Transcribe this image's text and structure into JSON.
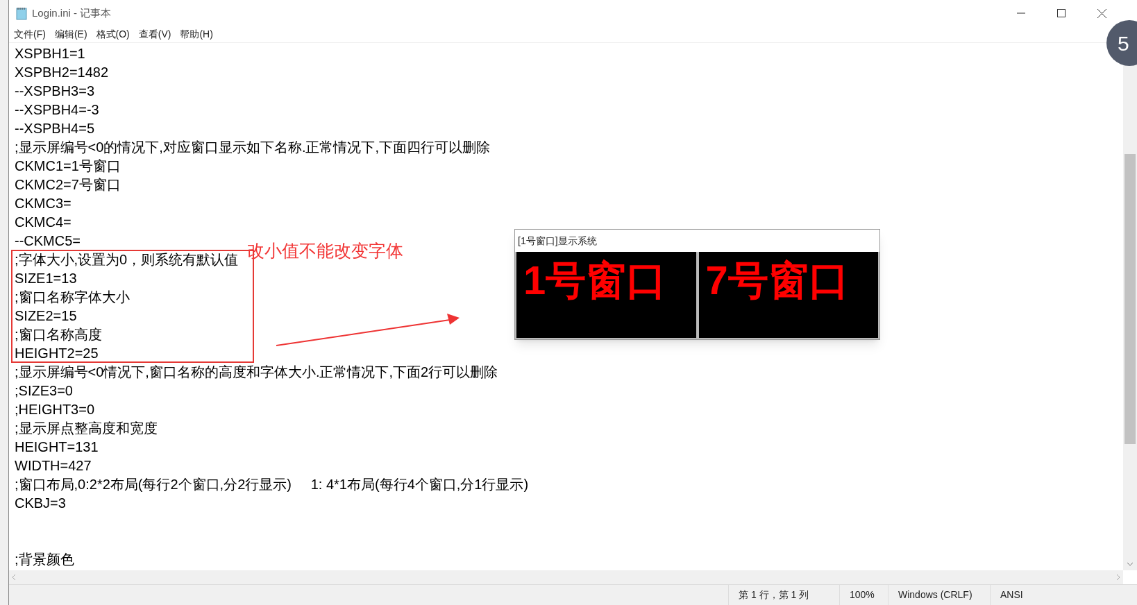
{
  "window": {
    "title": "Login.ini - 记事本"
  },
  "menu": [
    "文件(F)",
    "编辑(E)",
    "格式(O)",
    "查看(V)",
    "帮助(H)"
  ],
  "lines": [
    {
      "kind": "text",
      "text": "XSPBH1=1"
    },
    {
      "kind": "text",
      "text": "XSPBH2=1482"
    },
    {
      "kind": "text",
      "text": "--XSPBH3=3"
    },
    {
      "kind": "text",
      "text": "--XSPBH4=-3"
    },
    {
      "kind": "text",
      "text": "--XSPBH4=5"
    },
    {
      "kind": "text",
      "text": ";显示屏编号<0的情况下,对应窗口显示如下名称.正常情况下,下面四行可以删除"
    },
    {
      "kind": "text",
      "text": "CKMC1=1号窗口"
    },
    {
      "kind": "text",
      "text": "CKMC2=7号窗口"
    },
    {
      "kind": "text",
      "text": "CKMC3="
    },
    {
      "kind": "text",
      "text": "CKMC4="
    },
    {
      "kind": "text",
      "text": "--CKMC5="
    },
    {
      "kind": "text",
      "text": ";字体大小,设置为0，则系统有默认值"
    },
    {
      "kind": "text",
      "text": "SIZE1=13"
    },
    {
      "kind": "text",
      "text": ";窗口名称字体大小"
    },
    {
      "kind": "text",
      "text": "SIZE2=15"
    },
    {
      "kind": "text",
      "text": ";窗口名称高度"
    },
    {
      "kind": "text",
      "text": "HEIGHT2=25"
    },
    {
      "kind": "text",
      "text": ";显示屏编号<0情况下,窗口名称的高度和字体大小.正常情况下,下面2行可以删除"
    },
    {
      "kind": "text",
      "text": ";SIZE3=0"
    },
    {
      "kind": "text",
      "text": ";HEIGHT3=0"
    },
    {
      "kind": "text",
      "text": ";显示屏点整高度和宽度"
    },
    {
      "kind": "text",
      "text": "HEIGHT=131"
    },
    {
      "kind": "text",
      "text": "WIDTH=427"
    },
    {
      "kind": "text",
      "text": ";窗口布局,0:2*2布局(每行2个窗口,分2行显示)     1: 4*1布局(每行4个窗口,分1行显示)"
    },
    {
      "kind": "text",
      "text": "CKBJ=3"
    },
    {
      "kind": "blank"
    },
    {
      "kind": "blank"
    },
    {
      "kind": "text",
      "text": ";背景颜色"
    }
  ],
  "annotation": {
    "note": "改小值不能改变字体"
  },
  "preview_window": {
    "title": "[1号窗口]显示系统",
    "panes": [
      "1号窗口",
      "7号窗口"
    ]
  },
  "status_bar": [
    "第 1 行，第 1 列",
    "100%",
    "Windows (CRLF)",
    "ANSI"
  ],
  "badge": "5"
}
